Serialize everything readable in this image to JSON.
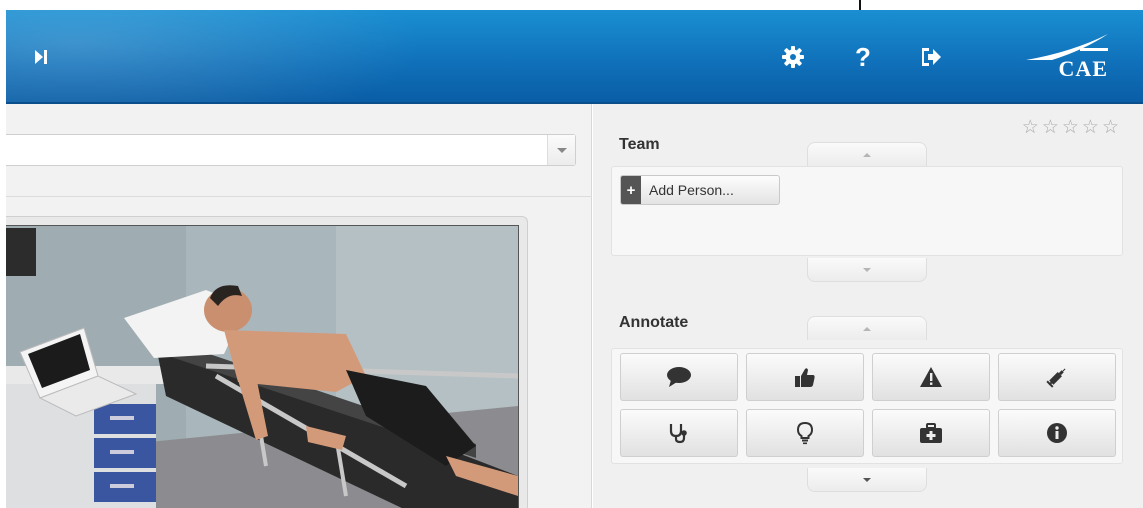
{
  "header": {
    "icons": [
      "skip-forward-icon",
      "gear-icon",
      "help-icon",
      "logout-icon"
    ],
    "help_glyph": "?",
    "logo_text": "CAE",
    "brand_color": "#1580c7"
  },
  "left": {
    "dropdown_value": ""
  },
  "right": {
    "rating_stars": [
      "☆",
      "☆",
      "☆",
      "☆",
      "☆"
    ],
    "rating_value": 0,
    "team_title": "Team",
    "add_person_label": "Add Person...",
    "add_person_icon": "+",
    "annotate_title": "Annotate",
    "annotate_icons": [
      "comment-icon",
      "thumbs-up-icon",
      "warning-icon",
      "syringe-icon",
      "stethoscope-icon",
      "lightbulb-icon",
      "medkit-icon",
      "info-icon"
    ]
  }
}
